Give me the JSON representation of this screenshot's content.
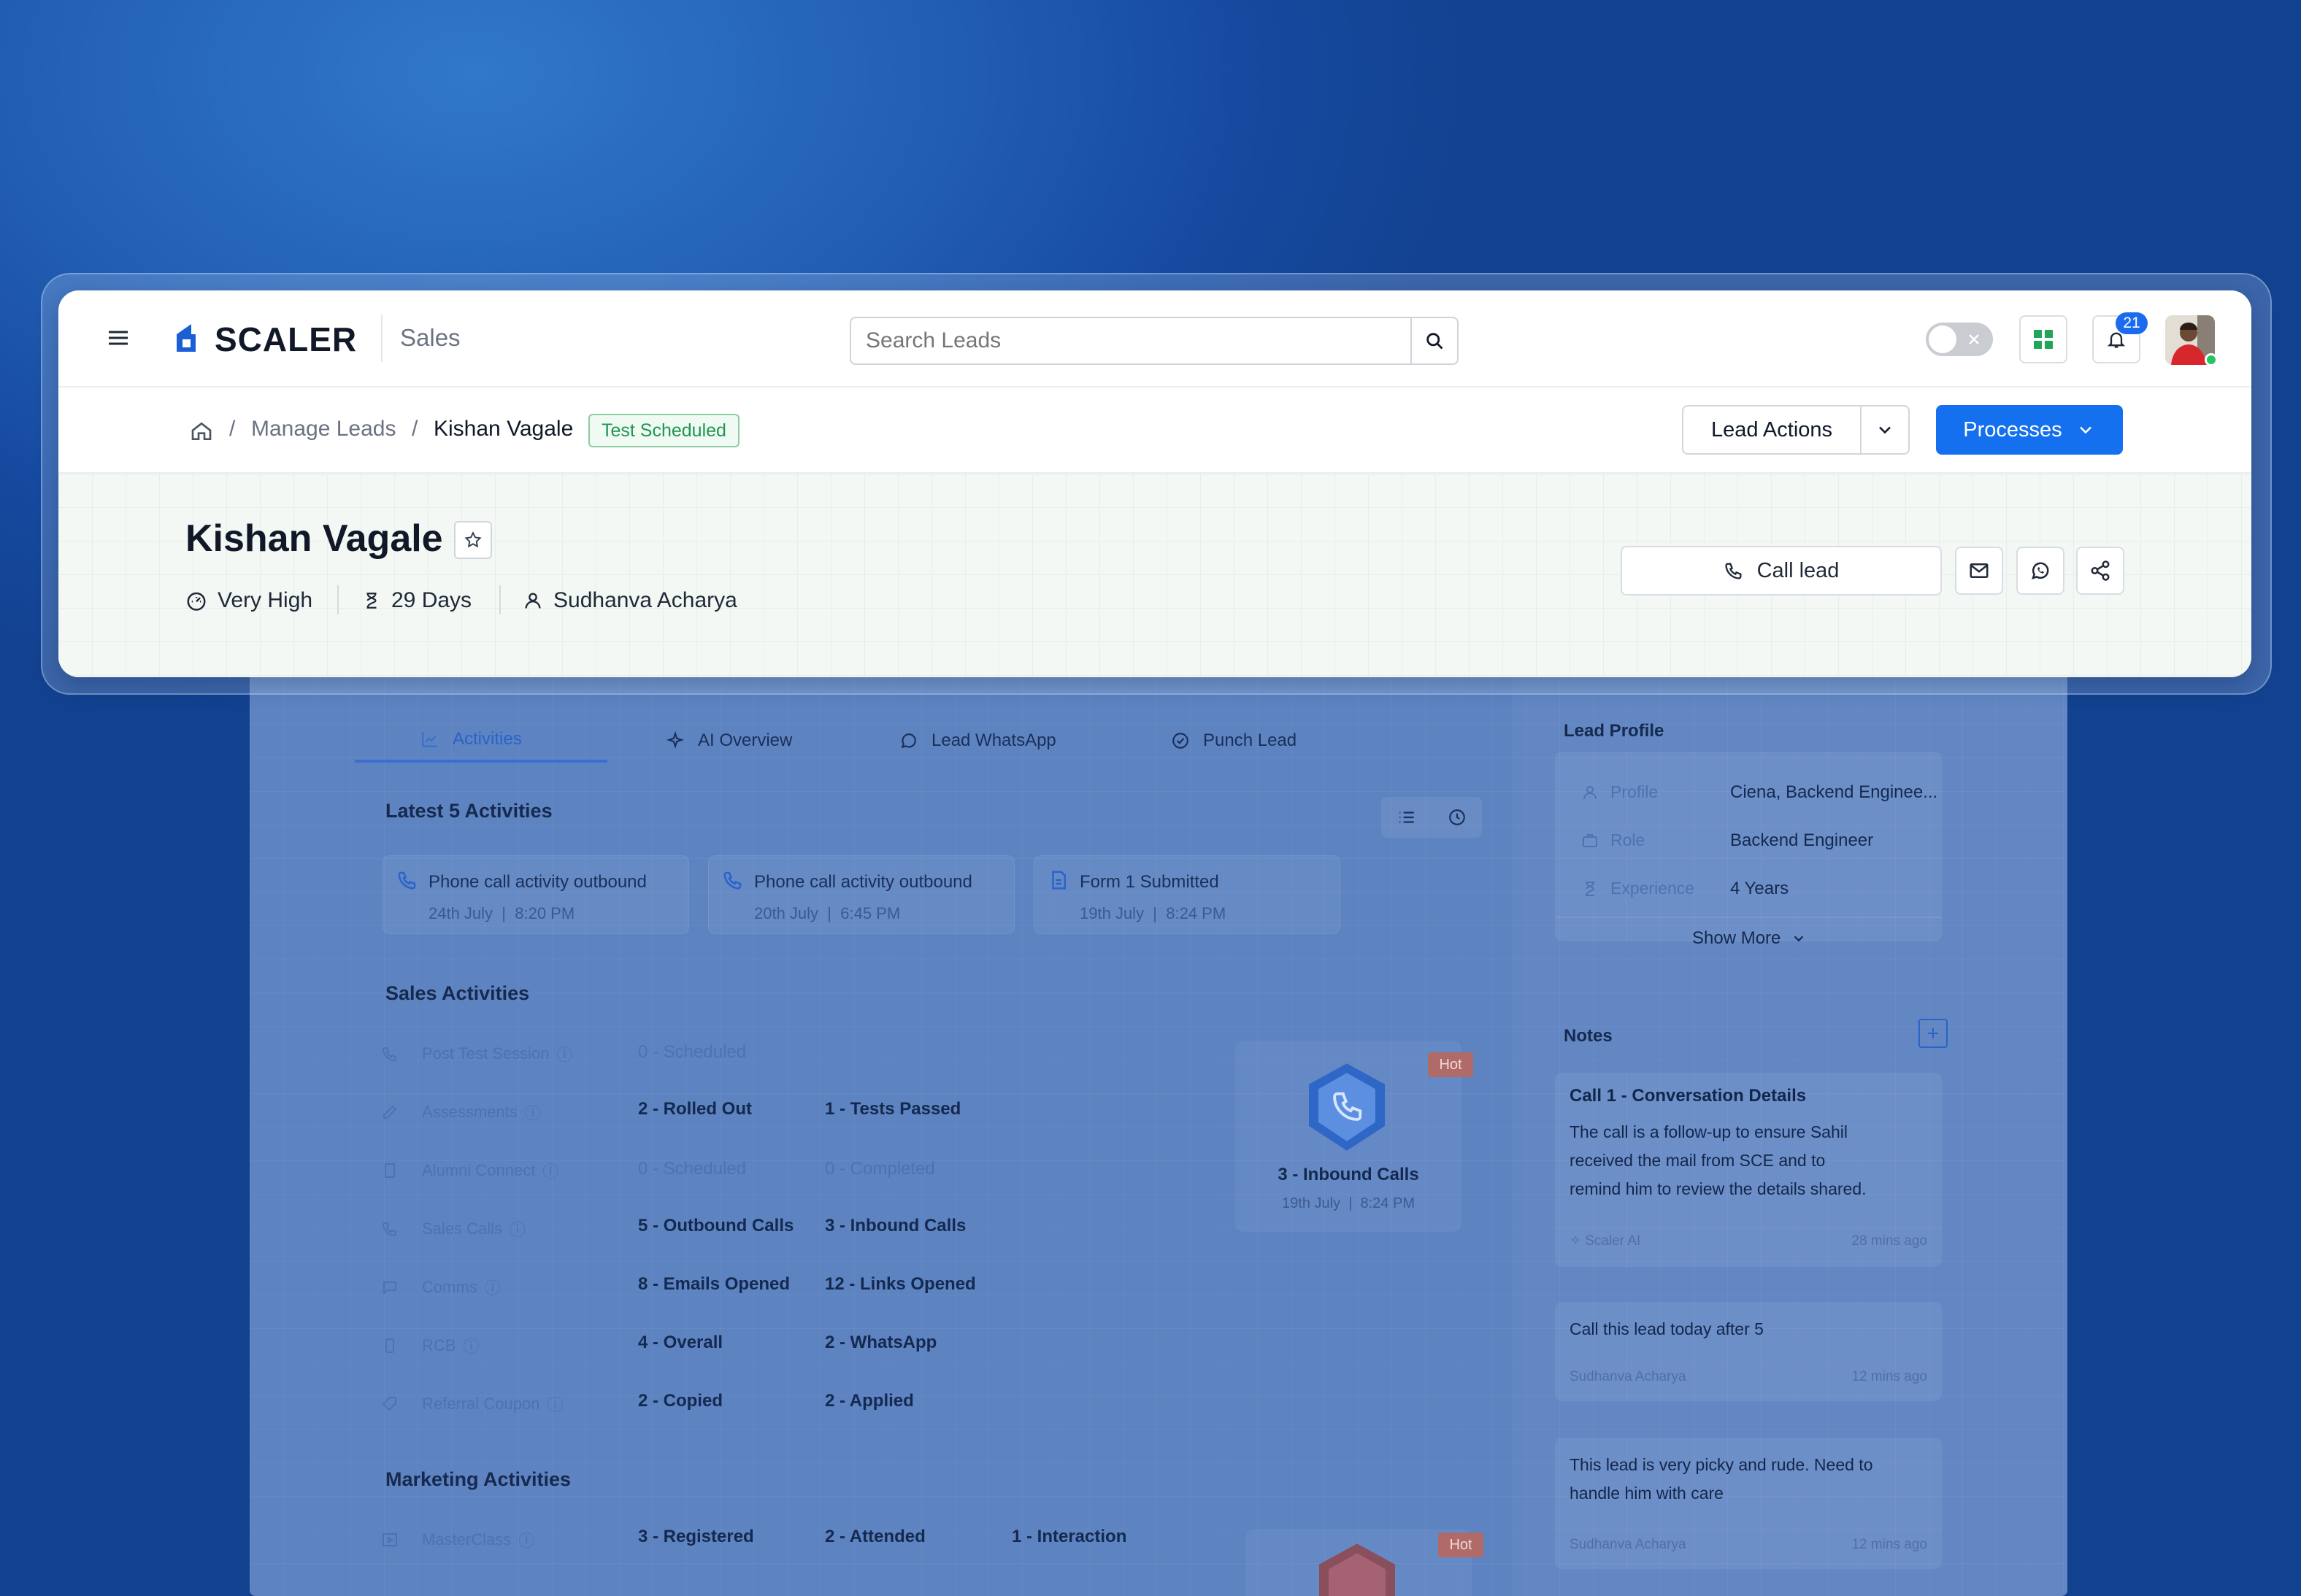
{
  "header": {
    "brand": "SCALER",
    "section": "Sales",
    "search_placeholder": "Search Leads",
    "notification_count": "21"
  },
  "breadcrumb": {
    "items": [
      "Manage Leads",
      "Kishan Vagale"
    ],
    "status_badge": "Test Scheduled"
  },
  "actions": {
    "lead_actions": "Lead Actions",
    "processes": "Processes",
    "call_lead": "Call lead"
  },
  "lead": {
    "name": "Kishan Vagale",
    "priority": "Very High",
    "age": "29 Days",
    "owner": "Sudhanva Acharya"
  },
  "tabs": [
    "Activities",
    "AI Overview",
    "Lead WhatsApp",
    "Punch Lead"
  ],
  "latest": {
    "title": "Latest 5 Activities",
    "items": [
      {
        "title": "Phone call activity outbound",
        "date": "24th July",
        "time": "8:20 PM"
      },
      {
        "title": "Phone call activity outbound",
        "date": "20th July",
        "time": "6:45 PM"
      },
      {
        "title": "Form 1 Submitted",
        "date": "19th July",
        "time": "8:24 PM"
      }
    ]
  },
  "sales": {
    "title": "Sales Activities",
    "rows": [
      {
        "label": "Post Test Session",
        "v1": "0 - Scheduled",
        "v2": ""
      },
      {
        "label": "Assessments",
        "v1": "2 - Rolled Out",
        "v2": "1 - Tests Passed"
      },
      {
        "label": "Alumni Connect",
        "v1": "0 - Scheduled",
        "v2": "0 - Completed"
      },
      {
        "label": "Sales Calls",
        "v1": "5 - Outbound Calls",
        "v2": "3 - Inbound Calls"
      },
      {
        "label": "Comms",
        "v1": "8 - Emails Opened",
        "v2": "12 - Links Opened"
      },
      {
        "label": "RCB",
        "v1": "4 - Overall",
        "v2": "2 - WhatsApp"
      },
      {
        "label": "Referral Coupon",
        "v1": "2 - Copied",
        "v2": "2 - Applied"
      }
    ],
    "highlight": {
      "badge": "Hot",
      "title": "3 - Inbound Calls",
      "date": "19th July",
      "time": "8:24 PM"
    }
  },
  "marketing": {
    "title": "Marketing Activities",
    "rows": [
      {
        "label": "MasterClass",
        "v1": "3 - Registered",
        "v2": "2 - Attended",
        "v3": "1 - Interaction"
      }
    ],
    "highlight": {
      "badge": "Hot"
    }
  },
  "profile": {
    "title": "Lead Profile",
    "fields": [
      {
        "label": "Profile",
        "value": "Ciena, Backend Enginee..."
      },
      {
        "label": "Role",
        "value": "Backend Engineer"
      },
      {
        "label": "Experience",
        "value": "4 Years"
      }
    ],
    "show_more": "Show More"
  },
  "notes": {
    "title": "Notes",
    "items": [
      {
        "title": "Call 1 - Conversation Details",
        "text": [
          "The call is a follow-up to ensure Sahil",
          "received the mail from SCE and to",
          "remind him to review the details shared."
        ],
        "author": "Scaler AI",
        "time": "28 mins ago"
      },
      {
        "title": "",
        "text": [
          "Call this lead today after 5"
        ],
        "author": "Sudhanva Acharya",
        "time": "12 mins ago"
      },
      {
        "title": "",
        "text": [
          "This lead is very picky and rude. Need to",
          "handle him with care"
        ],
        "author": "Sudhanva Acharya",
        "time": "12 mins ago"
      }
    ]
  }
}
